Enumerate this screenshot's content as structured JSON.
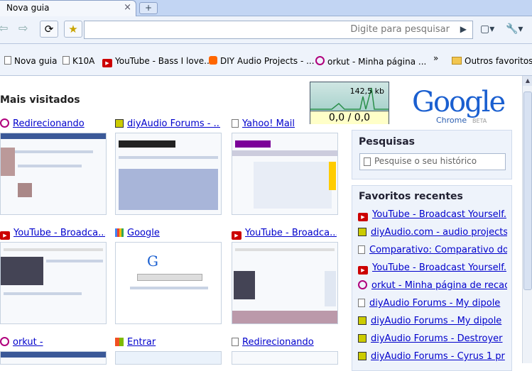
{
  "tabs": [
    {
      "label": "Nova guia",
      "close": "×"
    }
  ],
  "new_tab_symbol": "+",
  "toolbar": {
    "back": "⇦",
    "forward": "⇨",
    "reload": "⟳",
    "star": "★",
    "omnibox_placeholder": "Digite para pesquisar",
    "go": "▶",
    "page_menu": "▢▾",
    "tools_menu": "🔧▾"
  },
  "bookmarks": [
    {
      "label": "Nova guia",
      "icon": "doc"
    },
    {
      "label": "K10A",
      "icon": "doc"
    },
    {
      "label": "YouTube - Bass I love...",
      "icon": "youtube"
    },
    {
      "label": "DIY Audio Projects - ...",
      "icon": "blogger"
    },
    {
      "label": "orkut - Minha página ...",
      "icon": "orkut"
    },
    {
      "label": "»",
      "icon": ""
    },
    {
      "label": "Outros favoritos",
      "icon": "folder"
    }
  ],
  "most_visited": {
    "title": "Mais visitados",
    "items": [
      {
        "title": "Redirecionando",
        "icon": "orkut"
      },
      {
        "title": "diyAudio Forums - ...",
        "icon": "speaker"
      },
      {
        "title": "Yahoo! Mail",
        "icon": "doc"
      },
      {
        "title": "YouTube - Broadca...",
        "icon": "youtube"
      },
      {
        "title": "Google",
        "icon": "google"
      },
      {
        "title": "YouTube - Broadca...",
        "icon": "youtube"
      },
      {
        "title": "orkut -",
        "icon": "orkut"
      },
      {
        "title": "Entrar",
        "icon": "windows"
      },
      {
        "title": "Redirecionando",
        "icon": "doc"
      }
    ]
  },
  "net_monitor": {
    "rate": "142,5 kb",
    "values": "0,0 / 0,0"
  },
  "logo": {
    "text": "Google",
    "sub": "Chrome",
    "beta": "BETA"
  },
  "search_panel": {
    "title": "Pesquisas",
    "placeholder": "Pesquise o seu histórico"
  },
  "recent_favorites": {
    "title": "Favoritos recentes",
    "items": [
      {
        "label": "YouTube - Broadcast Yourself.",
        "icon": "youtube"
      },
      {
        "label": "diyAudio.com - audio projects",
        "icon": "speaker"
      },
      {
        "label": "Comparativo: Comparativo do",
        "icon": "doc"
      },
      {
        "label": "YouTube - Broadcast Yourself.",
        "icon": "youtube"
      },
      {
        "label": "orkut - Minha página de recados",
        "icon": "orkut"
      },
      {
        "label": "diyAudio Forums - My dipole",
        "icon": "doc"
      },
      {
        "label": "diyAudio Forums - My dipole",
        "icon": "speaker"
      },
      {
        "label": "diyAudio Forums - Destroyer",
        "icon": "speaker"
      },
      {
        "label": "diyAudio Forums - Cyrus 1 pr",
        "icon": "speaker"
      }
    ]
  },
  "colors": {
    "link": "#0000cc",
    "panel_bg": "#eef3fb",
    "tab_strip": "#c2d5f3"
  }
}
